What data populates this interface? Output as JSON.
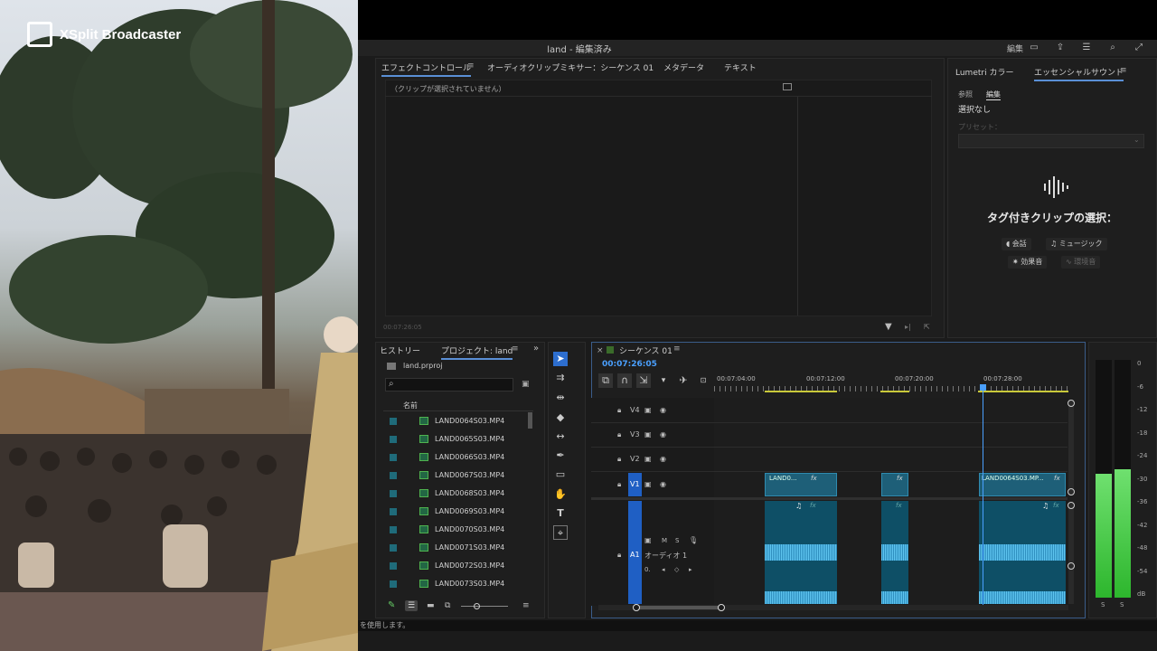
{
  "overlay": {
    "brand": "XSplit Broadcaster"
  },
  "app": {
    "title": "land - 編集済み",
    "header_right": {
      "edit_label": "編集"
    }
  },
  "effect_panel": {
    "tabs": [
      "エフェクトコントロール",
      "オーディオクリップミキサー：シーケンス 01",
      "メタデータ",
      "テキスト"
    ],
    "no_clip": "（クリップが選択されていません）",
    "time": "00:07:26:05"
  },
  "essential_sound": {
    "tabs": [
      "Lumetri カラー",
      "エッセンシャルサウンド"
    ],
    "subtabs": [
      "参照",
      "編集"
    ],
    "no_selection": "選択なし",
    "preset_label": "プリセット：",
    "heading": "タグ付きクリップの選択：",
    "types": [
      "会話",
      "ミュージック",
      "効果音",
      "環境音"
    ]
  },
  "project": {
    "tabs": [
      "ヒストリー",
      "プロジェクト: land"
    ],
    "file": "land.prproj",
    "column_name": "名前",
    "items": [
      "LAND0064S03.MP4",
      "LAND0065S03.MP4",
      "LAND0066S03.MP4",
      "LAND0067S03.MP4",
      "LAND0068S03.MP4",
      "LAND0069S03.MP4",
      "LAND0070S03.MP4",
      "LAND0071S03.MP4",
      "LAND0072S03.MP4",
      "LAND0073S03.MP4"
    ]
  },
  "timeline": {
    "title": "シーケンス 01",
    "timecode": "00:07:26:05",
    "ruler": [
      "00:07:04:00",
      "00:07:12:00",
      "00:07:20:00",
      "00:07:28:00"
    ],
    "tracks_video": [
      "V4",
      "V3",
      "V2",
      "V1"
    ],
    "track_audio": "A1",
    "audio_name": "オーディオ 1",
    "audio_buttons": [
      "M",
      "S"
    ],
    "audio_volume": "0.",
    "clip_fx": "fx",
    "clips": [
      "LAND0...",
      "",
      "LAND0064S03.MP..."
    ]
  },
  "meter": {
    "scale": [
      "0",
      "-6",
      "-12",
      "-18",
      "-24",
      "-30",
      "-36",
      "-42",
      "-48",
      "-54",
      "dB"
    ],
    "solo": [
      "S",
      "S"
    ],
    "levels": [
      0.52,
      0.54
    ]
  },
  "status": {
    "text": "を使用します。"
  }
}
